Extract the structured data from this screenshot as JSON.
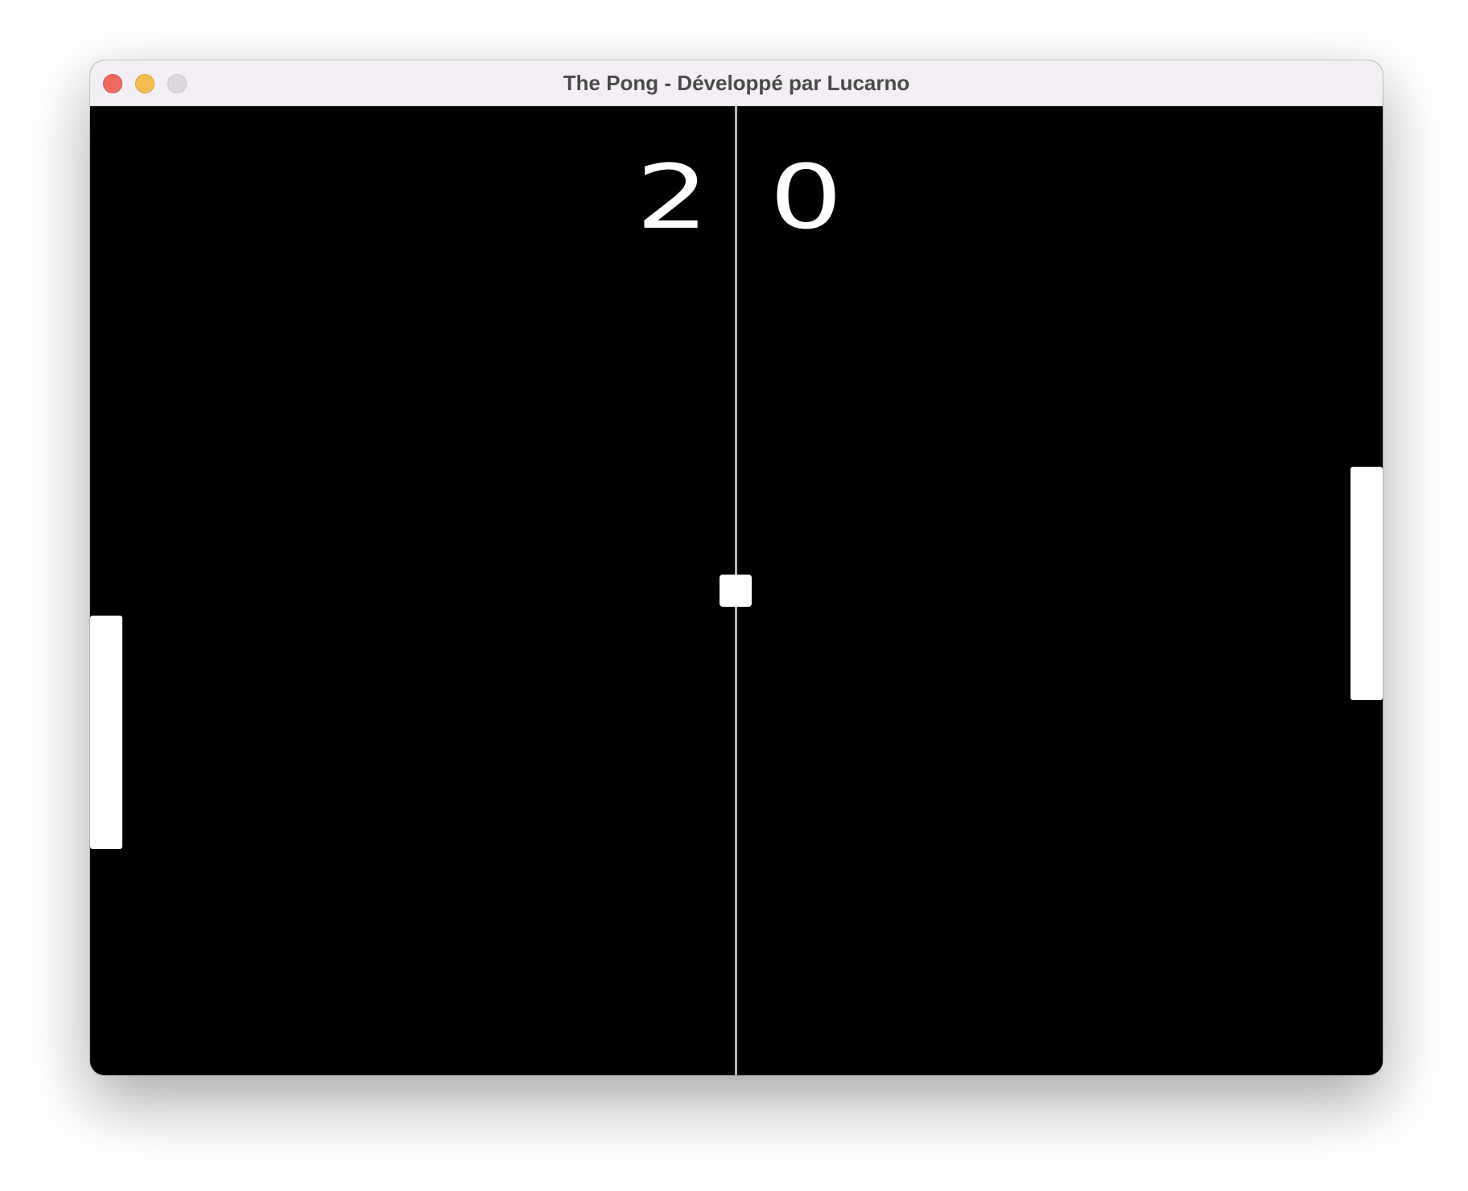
{
  "window": {
    "title": "The Pong - Développé par Lucarno"
  },
  "scores": {
    "left": "2",
    "right": "0"
  },
  "colors": {
    "court": "#000000",
    "net": "#b9b9b9",
    "paddle": "#ffffff",
    "ball": "#ffffff",
    "titlebar": "#f4eff5"
  }
}
